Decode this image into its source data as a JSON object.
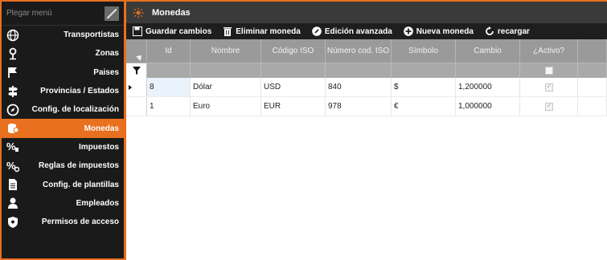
{
  "sidebar": {
    "header_label": "Plegar menú",
    "items": [
      {
        "label": "Transportistas",
        "icon": "globe-icon"
      },
      {
        "label": "Zonas",
        "icon": "map-pin-icon"
      },
      {
        "label": "Paises",
        "icon": "flag-icon"
      },
      {
        "label": "Provincias / Estados",
        "icon": "signpost-icon"
      },
      {
        "label": "Config. de localización",
        "icon": "compass-icon"
      },
      {
        "label": "Monedas",
        "icon": "coins-icon",
        "active": true
      },
      {
        "label": "Impuestos",
        "icon": "percent-icon"
      },
      {
        "label": "Reglas de impuestos",
        "icon": "percent-gear-icon"
      },
      {
        "label": "Config. de plantillas",
        "icon": "document-icon"
      },
      {
        "label": "Empleados",
        "icon": "person-icon"
      },
      {
        "label": "Permisos de acceso",
        "icon": "shield-icon"
      }
    ]
  },
  "window": {
    "title": "Monedas"
  },
  "toolbar": {
    "save_label": "Guardar cambios",
    "delete_label": "Eliminar moneda",
    "advanced_label": "Edición avanzada",
    "new_label": "Nueva moneda",
    "reload_label": "recargar"
  },
  "grid": {
    "columns": [
      "Id",
      "Nombre",
      "Código ISO",
      "Número cod. ISO",
      "Símbolo",
      "Cambio",
      "¿Activo?"
    ],
    "rows": [
      {
        "id": "8",
        "nombre": "Dólar",
        "iso": "USD",
        "num_iso": "840",
        "simbolo": "$",
        "cambio": "1,200000",
        "activo": true,
        "selected": true
      },
      {
        "id": "1",
        "nombre": "Euro",
        "iso": "EUR",
        "num_iso": "978",
        "simbolo": "€",
        "cambio": "1,000000",
        "activo": true,
        "selected": false
      }
    ]
  },
  "colors": {
    "accent": "#e8701f",
    "sidebar_bg": "#1a1a1a",
    "header_bg": "#9a9a9a"
  }
}
